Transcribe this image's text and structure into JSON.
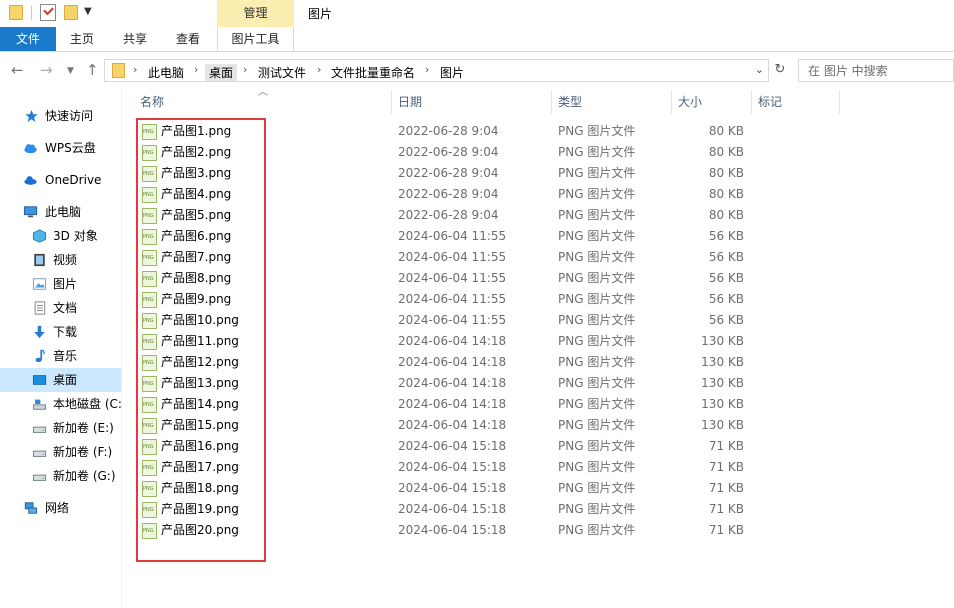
{
  "titlebar": {
    "manage_label": "管理",
    "window_title": "图片"
  },
  "ribbon": {
    "tabs": [
      "文件",
      "主页",
      "共享",
      "查看",
      "图片工具"
    ]
  },
  "address": {
    "crumbs": [
      "此电脑",
      "桌面",
      "测试文件",
      "文件批量重命名",
      "图片"
    ],
    "search_placeholder": "在 图片 中搜索"
  },
  "sidebar": {
    "items": [
      {
        "label": "快速访问",
        "icon": "star-icon"
      },
      {
        "label": "WPS云盘",
        "icon": "cloud-icon"
      },
      {
        "label": "OneDrive",
        "icon": "onedrive-icon"
      },
      {
        "label": "此电脑",
        "icon": "computer-icon"
      },
      {
        "label": "3D 对象",
        "icon": "cube-icon"
      },
      {
        "label": "视频",
        "icon": "video-icon"
      },
      {
        "label": "图片",
        "icon": "pictures-icon"
      },
      {
        "label": "文档",
        "icon": "documents-icon"
      },
      {
        "label": "下载",
        "icon": "download-icon"
      },
      {
        "label": "音乐",
        "icon": "music-icon"
      },
      {
        "label": "桌面",
        "icon": "desktop-icon"
      },
      {
        "label": "本地磁盘 (C:",
        "icon": "drive-icon"
      },
      {
        "label": "新加卷 (E:)",
        "icon": "drive-icon"
      },
      {
        "label": "新加卷 (F:)",
        "icon": "drive-icon"
      },
      {
        "label": "新加卷 (G:)",
        "icon": "drive-icon"
      },
      {
        "label": "网络",
        "icon": "network-icon"
      }
    ],
    "selected": "桌面"
  },
  "columns": {
    "name": "名称",
    "date": "日期",
    "type": "类型",
    "size": "大小",
    "tags": "标记"
  },
  "files": [
    {
      "name": "产品图1.png",
      "date": "2022-06-28 9:04",
      "type": "PNG 图片文件",
      "size": "80 KB"
    },
    {
      "name": "产品图2.png",
      "date": "2022-06-28 9:04",
      "type": "PNG 图片文件",
      "size": "80 KB"
    },
    {
      "name": "产品图3.png",
      "date": "2022-06-28 9:04",
      "type": "PNG 图片文件",
      "size": "80 KB"
    },
    {
      "name": "产品图4.png",
      "date": "2022-06-28 9:04",
      "type": "PNG 图片文件",
      "size": "80 KB"
    },
    {
      "name": "产品图5.png",
      "date": "2022-06-28 9:04",
      "type": "PNG 图片文件",
      "size": "80 KB"
    },
    {
      "name": "产品图6.png",
      "date": "2024-06-04 11:55",
      "type": "PNG 图片文件",
      "size": "56 KB"
    },
    {
      "name": "产品图7.png",
      "date": "2024-06-04 11:55",
      "type": "PNG 图片文件",
      "size": "56 KB"
    },
    {
      "name": "产品图8.png",
      "date": "2024-06-04 11:55",
      "type": "PNG 图片文件",
      "size": "56 KB"
    },
    {
      "name": "产品图9.png",
      "date": "2024-06-04 11:55",
      "type": "PNG 图片文件",
      "size": "56 KB"
    },
    {
      "name": "产品图10.png",
      "date": "2024-06-04 11:55",
      "type": "PNG 图片文件",
      "size": "56 KB"
    },
    {
      "name": "产品图11.png",
      "date": "2024-06-04 14:18",
      "type": "PNG 图片文件",
      "size": "130 KB"
    },
    {
      "name": "产品图12.png",
      "date": "2024-06-04 14:18",
      "type": "PNG 图片文件",
      "size": "130 KB"
    },
    {
      "name": "产品图13.png",
      "date": "2024-06-04 14:18",
      "type": "PNG 图片文件",
      "size": "130 KB"
    },
    {
      "name": "产品图14.png",
      "date": "2024-06-04 14:18",
      "type": "PNG 图片文件",
      "size": "130 KB"
    },
    {
      "name": "产品图15.png",
      "date": "2024-06-04 14:18",
      "type": "PNG 图片文件",
      "size": "130 KB"
    },
    {
      "name": "产品图16.png",
      "date": "2024-06-04 15:18",
      "type": "PNG 图片文件",
      "size": "71 KB"
    },
    {
      "name": "产品图17.png",
      "date": "2024-06-04 15:18",
      "type": "PNG 图片文件",
      "size": "71 KB"
    },
    {
      "name": "产品图18.png",
      "date": "2024-06-04 15:18",
      "type": "PNG 图片文件",
      "size": "71 KB"
    },
    {
      "name": "产品图19.png",
      "date": "2024-06-04 15:18",
      "type": "PNG 图片文件",
      "size": "71 KB"
    },
    {
      "name": "产品图20.png",
      "date": "2024-06-04 15:18",
      "type": "PNG 图片文件",
      "size": "71 KB"
    }
  ],
  "colors": {
    "accent": "#1979ca",
    "highlight_box": "#e03a3a",
    "manage_tab": "#fbeeb0",
    "selected_nav": "#cce8ff"
  }
}
